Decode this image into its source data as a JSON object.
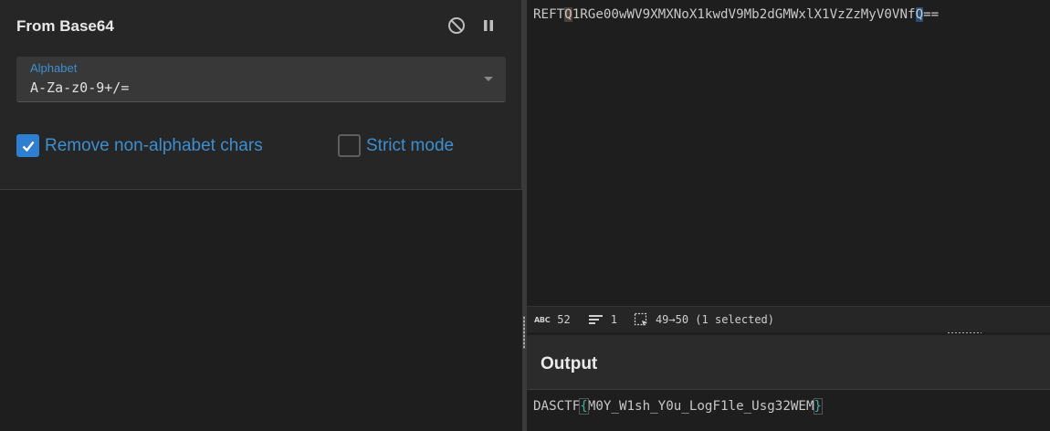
{
  "operation": {
    "title": "From Base64",
    "disable_icon": "disable-icon",
    "pause_icon": "pause-icon",
    "alphabet_label": "Alphabet",
    "alphabet_value": "A-Za-z0-9+/=",
    "remove_nonalpha_label": "Remove non-alphabet chars",
    "remove_nonalpha_checked": true,
    "strict_mode_label": "Strict mode",
    "strict_mode_checked": false
  },
  "input": {
    "text_before": "REFT",
    "text_hl1": "Q",
    "text_mid": "1RGe00wWV9XMXNoX1kwdV9Mb2dGMWxlX1VzZzMyV0VNf",
    "text_hl2": "Q",
    "text_after": "=="
  },
  "status": {
    "length_icon": "abc-icon",
    "length": "52",
    "lines_icon": "lines-icon",
    "lines": "1",
    "selection_icon": "selection-icon",
    "selection": "49→50 (1 selected)"
  },
  "output": {
    "title": "Output",
    "text_prefix": "DASCTF",
    "brace_open": "{",
    "text_body": "M0Y_W1sh_Y0u_LogF1le_Usg32WEM",
    "brace_close": "}"
  },
  "colors": {
    "accent": "#3e8ed0",
    "checkbox": "#2f7fd1",
    "background": "#1e1e1e"
  }
}
